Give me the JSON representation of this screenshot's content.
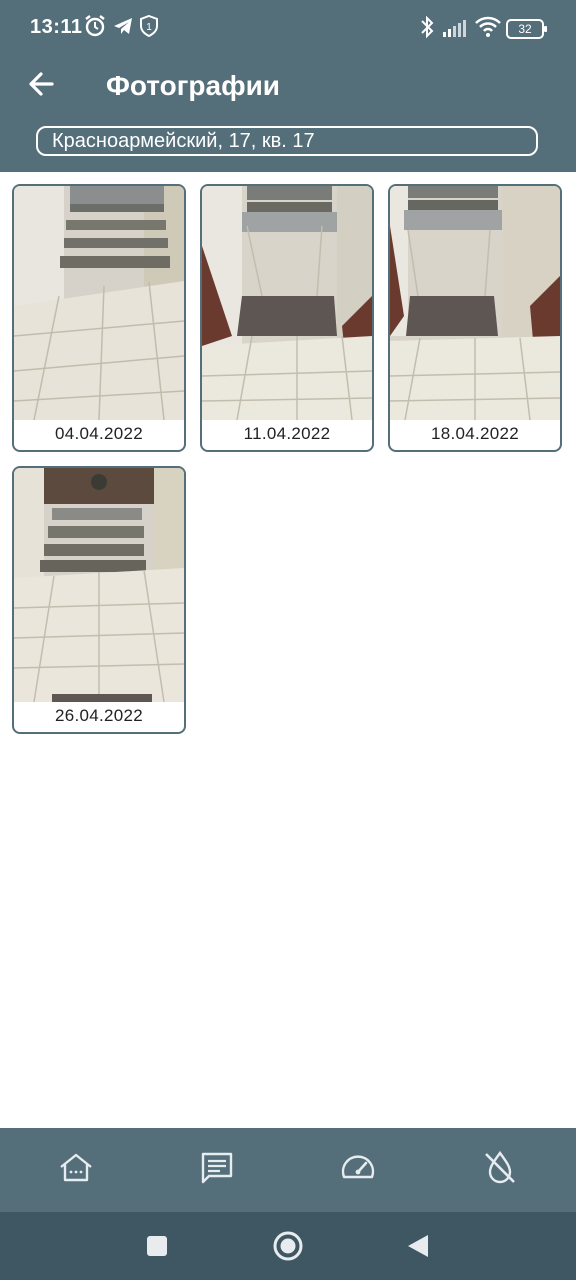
{
  "status_bar": {
    "time": "13:11",
    "battery": "32",
    "icons": [
      "alarm-icon",
      "telegram-icon",
      "shield-notification-icon",
      "bluetooth-icon",
      "signal-icon",
      "wifi-icon",
      "battery-icon"
    ]
  },
  "header": {
    "title": "Фотографии",
    "address": "Красноармейский, 17, кв. 17",
    "back_icon": "arrow-left-icon"
  },
  "photos": [
    {
      "date": "04.04.2022"
    },
    {
      "date": "11.04.2022"
    },
    {
      "date": "18.04.2022"
    },
    {
      "date": "26.04.2022"
    }
  ],
  "bottom_nav": {
    "items": [
      "home-icon",
      "messages-icon",
      "meter-icon",
      "water-off-icon"
    ]
  },
  "system_nav": [
    "recents-icon",
    "home-circle-icon",
    "back-triangle-icon"
  ],
  "colors": {
    "primary": "#546e7a",
    "system_nav": "#3f5762",
    "background": "#ffffff"
  }
}
